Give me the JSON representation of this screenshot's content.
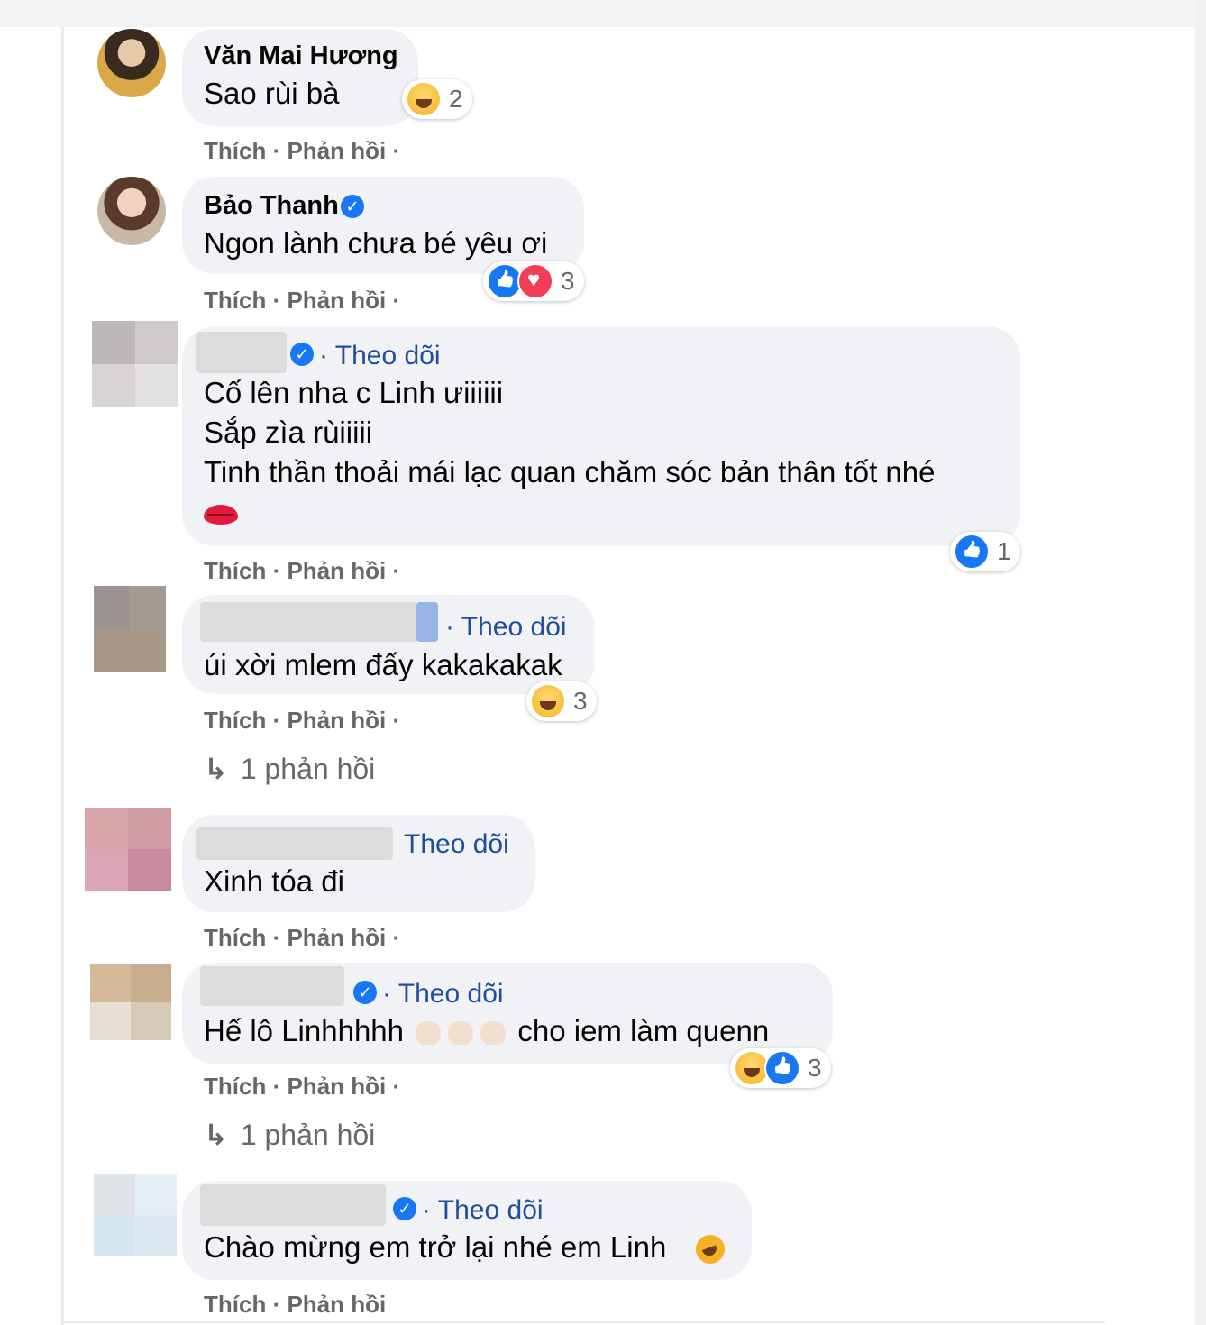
{
  "actions": {
    "like": "Thích",
    "sep": " · ",
    "reply": "Phản hồi"
  },
  "follow_label": "Theo dõi",
  "comments": [
    {
      "author": "Văn Mai Hương",
      "lines": [
        "Sao rùi bà"
      ],
      "reactions": [
        "haha"
      ],
      "reaction_count": "2"
    },
    {
      "author": "Bảo Thanh",
      "verified": true,
      "lines": [
        "Ngon lành chưa bé yêu ơi"
      ],
      "reactions": [
        "like",
        "love"
      ],
      "reaction_count": "3"
    },
    {
      "verified": true,
      "follow": true,
      "lines": [
        "Cố lên nha c Linh ưiiiiii",
        "Sắp zìa rùiiiii",
        "Tinh thần thoải mái lạc quan chăm sóc bản thân tốt nhé"
      ],
      "trailing_emoji": "kiss-lips",
      "reactions": [
        "like"
      ],
      "reaction_count": "1"
    },
    {
      "follow": true,
      "lines": [
        "úi xời mlem đấy kakakakak"
      ],
      "reactions": [
        "haha"
      ],
      "reaction_count": "3",
      "replies": "1 phản hồi"
    },
    {
      "follow": true,
      "lines": [
        "Xinh tóa đi"
      ]
    },
    {
      "verified": true,
      "follow": true,
      "text_before": "Hế lô Linhhhhh",
      "text_after": "cho iem làm quenn",
      "inline_emojis": [
        "clapping-hands",
        "clapping-hands",
        "clapping-hands"
      ],
      "reactions": [
        "haha",
        "like"
      ],
      "reaction_count": "3",
      "replies": "1 phản hồi"
    },
    {
      "verified": true,
      "follow": true,
      "lines": [
        "Chào mừng em trở lại nhé em Linh"
      ],
      "trailing_emoji": "rofl"
    }
  ],
  "colors": {
    "bubble": "#f0f2f5",
    "follow_link": "#1f4f9c",
    "verified_badge": "#1877f2",
    "meta_text": "#65676b"
  }
}
